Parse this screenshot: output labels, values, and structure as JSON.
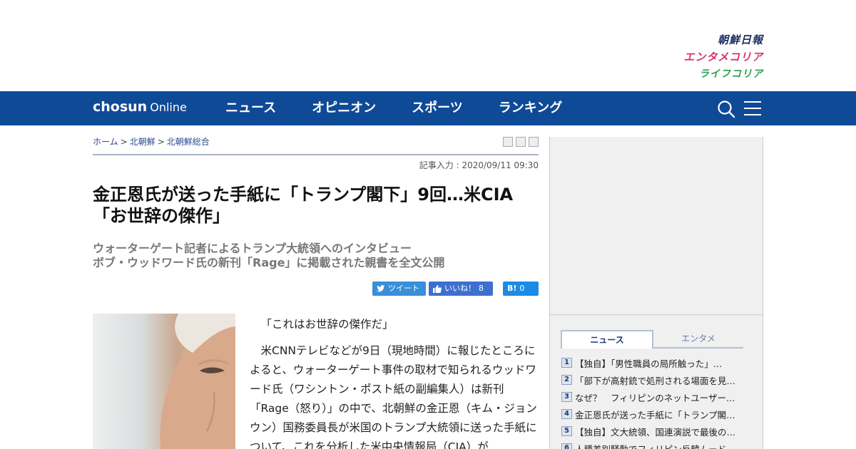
{
  "brands": {
    "main": "朝鮮日報",
    "entame": "エンタメコリア",
    "life": "ライフコリア"
  },
  "nav": {
    "logo_bold": "chosun",
    "logo_light": "Online",
    "items": [
      "ニュース",
      "オピニオン",
      "スポーツ",
      "ランキング"
    ],
    "search_icon": "search-icon",
    "menu_icon": "hamburger-menu-icon"
  },
  "breadcrumb": {
    "items": [
      "ホーム",
      "北朝鮮",
      "北朝鮮総合"
    ],
    "separator": ">"
  },
  "article": {
    "timestamp": "記事入力 : 2020/09/11 09:30",
    "headline": "金正恩氏が送った手紙に「トランプ閣下」9回…米CIA「お世辞の傑作」",
    "subhead_line1": "ウォーターゲート記者によるトランプ大統領へのインタビュー",
    "subhead_line2": "ボブ・ウッドワード氏の新刊「Rage」に掲載された親書を全文公開",
    "quote": "「これはお世辞の傑作だ」",
    "body": "米CNNテレビなどが9日（現地時間）に報じたところによると、ウォーターゲート事件の取材で知られるウッドワード氏（ワシントン・ポスト紙の副編集人）は新刊「Rage（怒り）」の中で、北朝鮮の金正恩（キム・ジョンウン）国務委員長が米国のトランプ大統領に送った手紙について、これを分析した米中央情報局（CIA）が"
  },
  "share": {
    "tweet_label": "ツイート",
    "like_label": "いいね！",
    "like_count": "8",
    "hatena_label": "B!",
    "hatena_count": "0"
  },
  "sidebar": {
    "tabs": [
      "ニュース",
      "エンタメ"
    ],
    "ranking": [
      "【独自】「男性職員の局所触った」…",
      "「部下が高射銃で処刑される場面を見…",
      "なぜ？　フィリピンのネットユーザー…",
      "金正恩氏が送った手紙に「トランプ閣…",
      "【独自】文大統領、国連演説で最後の…",
      "人種差別騒動でフィリピン反韓ムード…"
    ]
  },
  "colors": {
    "nav_bg": "#0f4a97",
    "brand_main": "#1c2f63",
    "brand_entame": "#d9306e",
    "brand_life": "#2aa150"
  }
}
